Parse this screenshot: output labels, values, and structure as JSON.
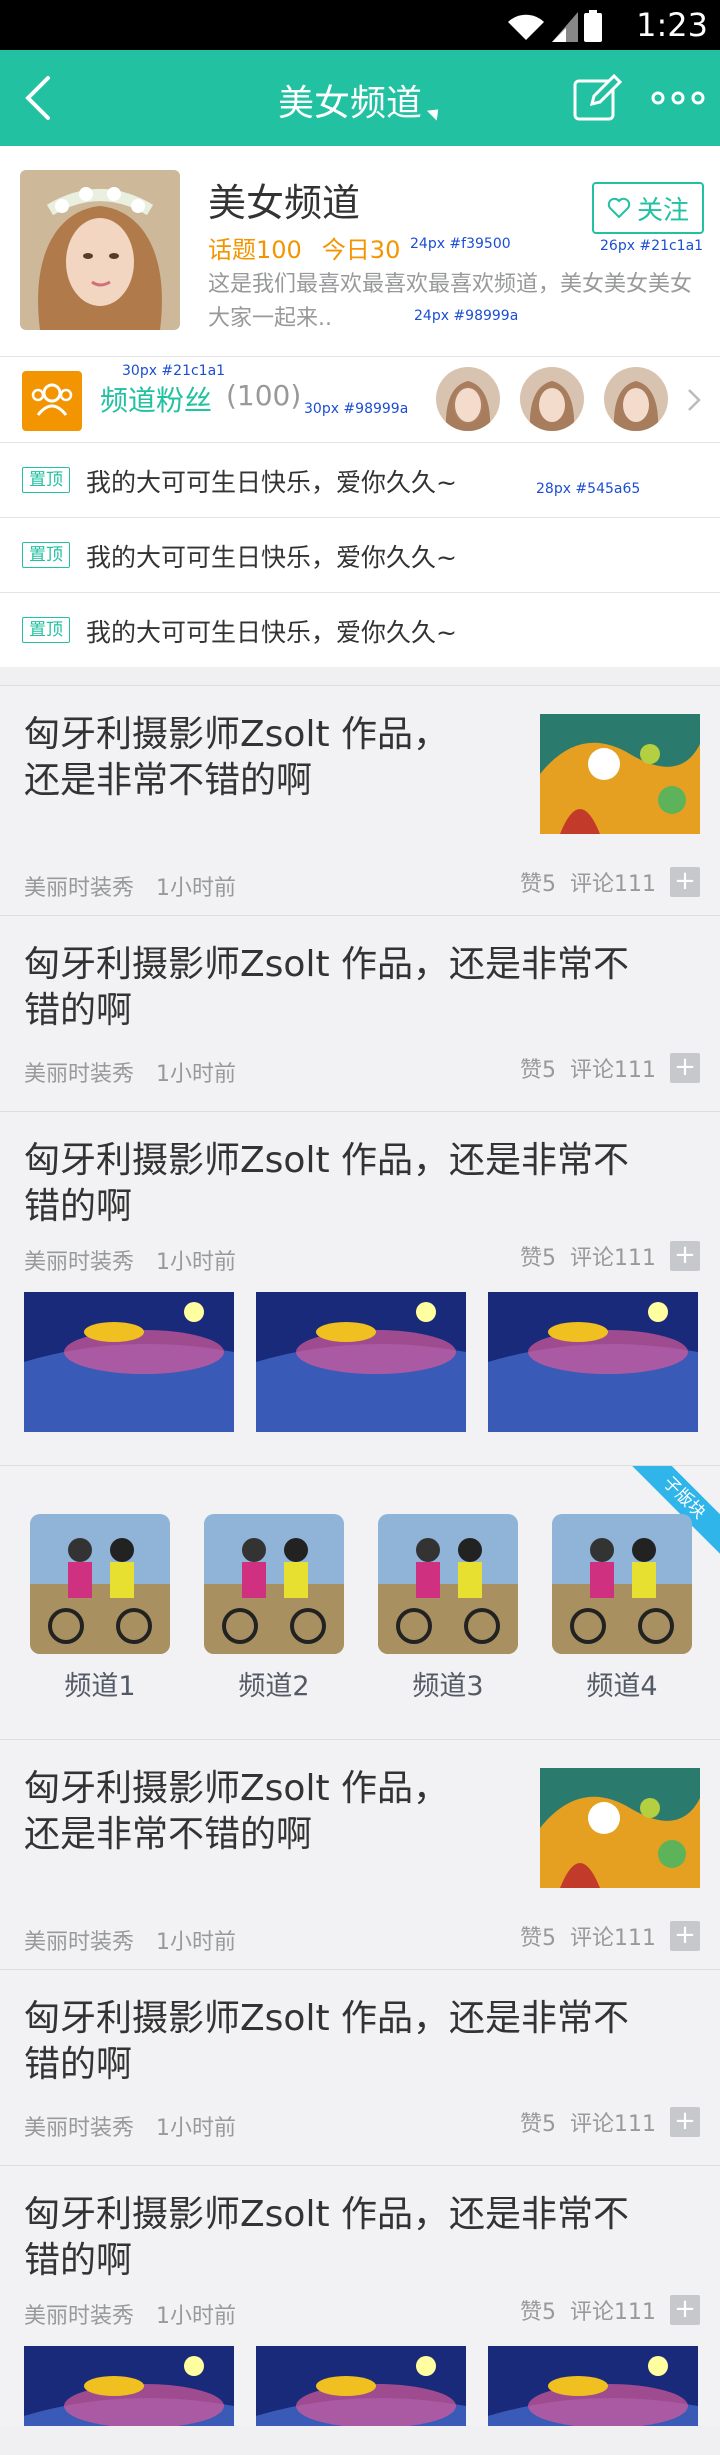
{
  "status_bar": {
    "time": "1:23"
  },
  "nav": {
    "title": "美女频道"
  },
  "channel": {
    "name": "美女频道",
    "follow_label": "关注",
    "topics": "话题100",
    "today": "今日30",
    "description": "这是我们最喜欢最喜欢最喜欢频道，美女美女美女大家一起来..",
    "fans_label": "频道粉丝",
    "fans_count": "(100)"
  },
  "annotations": {
    "follow": "26px  #21c1a1",
    "stats": "24px  #f39500",
    "desc": "24px  #98999a",
    "fans_label": "30px  #21c1a1",
    "fans_count": "30px  #98999a",
    "pinned": "28px  #545a65"
  },
  "pinned": {
    "badge": "置顶",
    "items": [
      "我的大可可生日快乐，爱你久久~",
      "我的大可可生日快乐，爱你久久~",
      "我的大可可生日快乐，爱你久久~"
    ]
  },
  "posts": [
    {
      "title": "匈牙利摄影师Zsolt 作品，\n还是非常不错的啊",
      "source": "美丽时装秀",
      "time": "1小时前",
      "likes": "赞5",
      "comments": "评论111"
    },
    {
      "title": "匈牙利摄影师Zsolt 作品，还是非常不\n错的啊",
      "source": "美丽时装秀",
      "time": "1小时前",
      "likes": "赞5",
      "comments": "评论111"
    },
    {
      "title": "匈牙利摄影师Zsolt 作品，还是非常不\n错的啊",
      "source": "美丽时装秀",
      "time": "1小时前",
      "likes": "赞5",
      "comments": "评论111"
    },
    {
      "title": "匈牙利摄影师Zsolt 作品，\n还是非常不错的啊",
      "source": "美丽时装秀",
      "time": "1小时前",
      "likes": "赞5",
      "comments": "评论111"
    },
    {
      "title": "匈牙利摄影师Zsolt 作品，还是非常不\n错的啊",
      "source": "美丽时装秀",
      "time": "1小时前",
      "likes": "赞5",
      "comments": "评论111"
    },
    {
      "title": "匈牙利摄影师Zsolt 作品，还是非常不\n错的啊",
      "source": "美丽时装秀",
      "time": "1小时前",
      "likes": "赞5",
      "comments": "评论111"
    }
  ],
  "sub_boards": {
    "ribbon": "子版块",
    "items": [
      "频道1",
      "频道2",
      "频道3",
      "频道4"
    ]
  },
  "colors": {
    "accent": "#21c1a1",
    "orange": "#f39500",
    "gray": "#98999a",
    "text": "#545a65"
  }
}
